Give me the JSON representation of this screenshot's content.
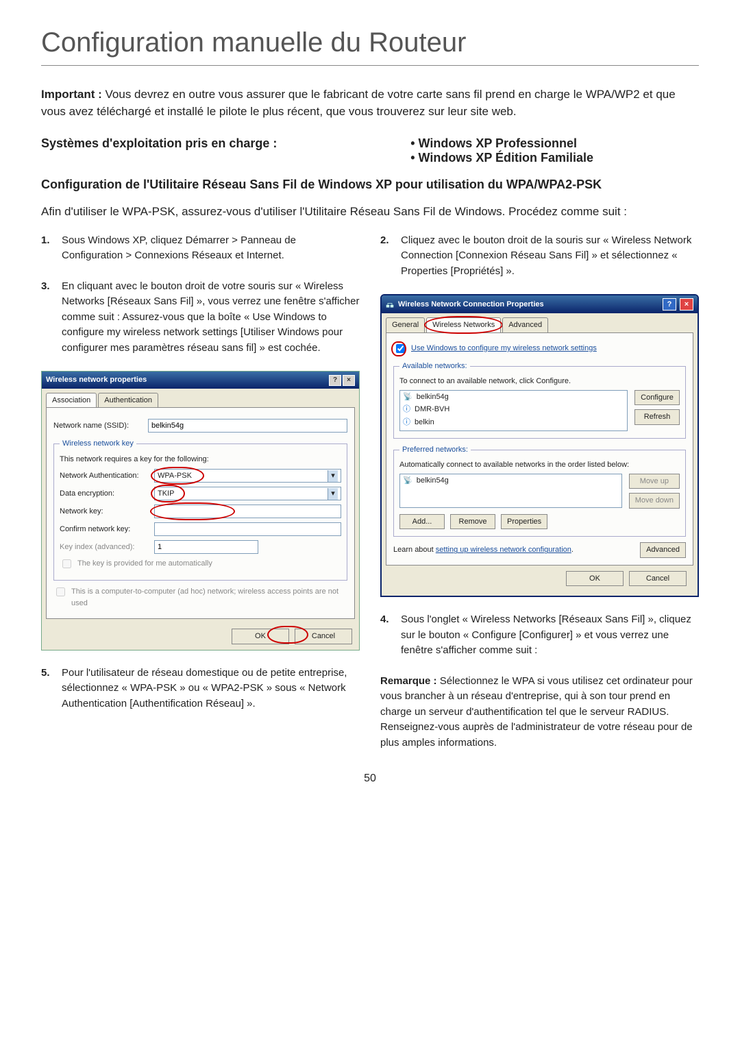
{
  "title": "Configuration manuelle du Routeur",
  "intro_strong": "Important :",
  "intro_text": " Vous devrez en outre vous assurer que le fabricant de votre carte sans fil prend en charge le WPA/WP2 et que vous avez téléchargé et installé le pilote le plus récent, que vous trouverez sur leur site web.",
  "os_left": "Systèmes d'exploitation pris en charge :",
  "os_right_1": "• Windows XP Professionnel",
  "os_right_2": "• Windows XP Édition Familiale",
  "subhead": "Configuration de l'Utilitaire Réseau Sans Fil de Windows XP pour utilisation du WPA/WPA2-PSK",
  "procintro": "Afin d'utiliser le WPA-PSK, assurez-vous d'utiliser l'Utilitaire Réseau Sans Fil de Windows. Procédez comme suit :",
  "steps": {
    "s1": {
      "n": "1.",
      "t": "Sous Windows XP, cliquez Démarrer > Panneau de Configuration > Connexions Réseaux et Internet."
    },
    "s2": {
      "n": "2.",
      "t": "Cliquez avec le bouton droit de la souris sur « Wireless Network Connection [Connexion Réseau Sans Fil] » et sélectionnez « Properties [Propriétés] »."
    },
    "s3": {
      "n": "3.",
      "t": "En cliquant avec le bouton droit de votre souris sur « Wireless Networks [Réseaux Sans Fil] », vous verrez une fenêtre s'afficher comme suit : Assurez-vous que la boîte « Use Windows to configure my wireless network settings [Utiliser Windows pour configurer mes paramètres réseau sans fil] » est cochée."
    },
    "s4": {
      "n": "4.",
      "t": "Sous l'onglet « Wireless Networks [Réseaux Sans Fil] », cliquez sur le bouton « Configure [Configurer] » et vous verrez une fenêtre s'afficher comme suit :"
    },
    "s5": {
      "n": "5.",
      "t": "Pour l'utilisateur de réseau domestique ou de petite entreprise, sélectionnez « WPA-PSK » ou « WPA2-PSK » sous « Network Authentication [Authentification Réseau] »."
    },
    "remark": {
      "b": "Remarque :",
      "t": " Sélectionnez le WPA si vous utilisez cet ordinateur pour vous brancher à un réseau d'entreprise, qui à son tour prend en charge un serveur d'authentification tel que le serveur RADIUS. Renseignez-vous auprès de l'administrateur de votre réseau pour de plus amples informations."
    }
  },
  "dlg1": {
    "title": "Wireless network properties",
    "tabs": {
      "assoc": "Association",
      "auth": "Authentication"
    },
    "ssid_label": "Network name (SSID):",
    "ssid_value": "belkin54g",
    "key_legend": "Wireless network key",
    "key_desc": "This network requires a key for the following:",
    "netauth_label": "Network Authentication:",
    "netauth_value": "WPA-PSK",
    "enc_label": "Data encryption:",
    "enc_value": "TKIP",
    "nkey_label": "Network key:",
    "ckey_label": "Confirm network key:",
    "idx_label": "Key index (advanced):",
    "idx_value": "1",
    "auto_label": "The key is provided for me automatically",
    "adhoc_label": "This is a computer-to-computer (ad hoc) network; wireless access points are not used",
    "ok": "OK",
    "cancel": "Cancel"
  },
  "dlg2": {
    "title": "Wireless Network Connection Properties",
    "tabs": {
      "gen": "General",
      "wn": "Wireless Networks",
      "adv": "Advanced"
    },
    "usewin": "Use Windows to configure my wireless network settings",
    "avail_legend": "Available networks:",
    "avail_desc": "To connect to an available network, click Configure.",
    "avail_items": [
      "belkin54g",
      "DMR-BVH",
      "belkin"
    ],
    "configure": "Configure",
    "refresh": "Refresh",
    "pref_legend": "Preferred networks:",
    "pref_desc": "Automatically connect to available networks in the order listed below:",
    "pref_items": [
      "belkin54g"
    ],
    "moveup": "Move up",
    "movedown": "Move down",
    "add": "Add...",
    "remove": "Remove",
    "properties": "Properties",
    "learn1": "Learn about ",
    "learn_link": "setting up wireless network configuration",
    "advanced": "Advanced",
    "ok": "OK",
    "cancel": "Cancel"
  },
  "page_number": "50"
}
